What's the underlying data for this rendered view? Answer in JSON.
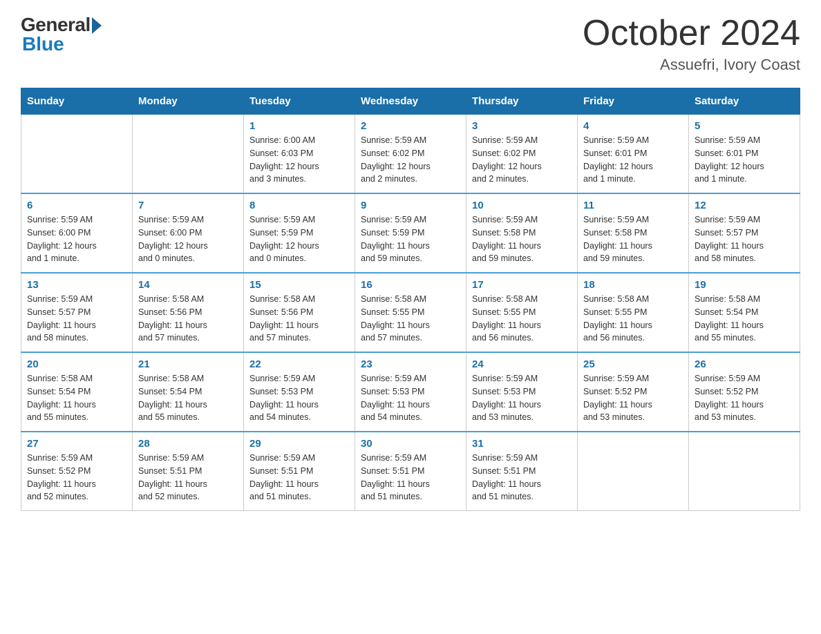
{
  "logo": {
    "general": "General",
    "blue": "Blue"
  },
  "title": "October 2024",
  "subtitle": "Assuefri, Ivory Coast",
  "weekdays": [
    "Sunday",
    "Monday",
    "Tuesday",
    "Wednesday",
    "Thursday",
    "Friday",
    "Saturday"
  ],
  "weeks": [
    [
      {
        "day": "",
        "info": ""
      },
      {
        "day": "",
        "info": ""
      },
      {
        "day": "1",
        "info": "Sunrise: 6:00 AM\nSunset: 6:03 PM\nDaylight: 12 hours\nand 3 minutes."
      },
      {
        "day": "2",
        "info": "Sunrise: 5:59 AM\nSunset: 6:02 PM\nDaylight: 12 hours\nand 2 minutes."
      },
      {
        "day": "3",
        "info": "Sunrise: 5:59 AM\nSunset: 6:02 PM\nDaylight: 12 hours\nand 2 minutes."
      },
      {
        "day": "4",
        "info": "Sunrise: 5:59 AM\nSunset: 6:01 PM\nDaylight: 12 hours\nand 1 minute."
      },
      {
        "day": "5",
        "info": "Sunrise: 5:59 AM\nSunset: 6:01 PM\nDaylight: 12 hours\nand 1 minute."
      }
    ],
    [
      {
        "day": "6",
        "info": "Sunrise: 5:59 AM\nSunset: 6:00 PM\nDaylight: 12 hours\nand 1 minute."
      },
      {
        "day": "7",
        "info": "Sunrise: 5:59 AM\nSunset: 6:00 PM\nDaylight: 12 hours\nand 0 minutes."
      },
      {
        "day": "8",
        "info": "Sunrise: 5:59 AM\nSunset: 5:59 PM\nDaylight: 12 hours\nand 0 minutes."
      },
      {
        "day": "9",
        "info": "Sunrise: 5:59 AM\nSunset: 5:59 PM\nDaylight: 11 hours\nand 59 minutes."
      },
      {
        "day": "10",
        "info": "Sunrise: 5:59 AM\nSunset: 5:58 PM\nDaylight: 11 hours\nand 59 minutes."
      },
      {
        "day": "11",
        "info": "Sunrise: 5:59 AM\nSunset: 5:58 PM\nDaylight: 11 hours\nand 59 minutes."
      },
      {
        "day": "12",
        "info": "Sunrise: 5:59 AM\nSunset: 5:57 PM\nDaylight: 11 hours\nand 58 minutes."
      }
    ],
    [
      {
        "day": "13",
        "info": "Sunrise: 5:59 AM\nSunset: 5:57 PM\nDaylight: 11 hours\nand 58 minutes."
      },
      {
        "day": "14",
        "info": "Sunrise: 5:58 AM\nSunset: 5:56 PM\nDaylight: 11 hours\nand 57 minutes."
      },
      {
        "day": "15",
        "info": "Sunrise: 5:58 AM\nSunset: 5:56 PM\nDaylight: 11 hours\nand 57 minutes."
      },
      {
        "day": "16",
        "info": "Sunrise: 5:58 AM\nSunset: 5:55 PM\nDaylight: 11 hours\nand 57 minutes."
      },
      {
        "day": "17",
        "info": "Sunrise: 5:58 AM\nSunset: 5:55 PM\nDaylight: 11 hours\nand 56 minutes."
      },
      {
        "day": "18",
        "info": "Sunrise: 5:58 AM\nSunset: 5:55 PM\nDaylight: 11 hours\nand 56 minutes."
      },
      {
        "day": "19",
        "info": "Sunrise: 5:58 AM\nSunset: 5:54 PM\nDaylight: 11 hours\nand 55 minutes."
      }
    ],
    [
      {
        "day": "20",
        "info": "Sunrise: 5:58 AM\nSunset: 5:54 PM\nDaylight: 11 hours\nand 55 minutes."
      },
      {
        "day": "21",
        "info": "Sunrise: 5:58 AM\nSunset: 5:54 PM\nDaylight: 11 hours\nand 55 minutes."
      },
      {
        "day": "22",
        "info": "Sunrise: 5:59 AM\nSunset: 5:53 PM\nDaylight: 11 hours\nand 54 minutes."
      },
      {
        "day": "23",
        "info": "Sunrise: 5:59 AM\nSunset: 5:53 PM\nDaylight: 11 hours\nand 54 minutes."
      },
      {
        "day": "24",
        "info": "Sunrise: 5:59 AM\nSunset: 5:53 PM\nDaylight: 11 hours\nand 53 minutes."
      },
      {
        "day": "25",
        "info": "Sunrise: 5:59 AM\nSunset: 5:52 PM\nDaylight: 11 hours\nand 53 minutes."
      },
      {
        "day": "26",
        "info": "Sunrise: 5:59 AM\nSunset: 5:52 PM\nDaylight: 11 hours\nand 53 minutes."
      }
    ],
    [
      {
        "day": "27",
        "info": "Sunrise: 5:59 AM\nSunset: 5:52 PM\nDaylight: 11 hours\nand 52 minutes."
      },
      {
        "day": "28",
        "info": "Sunrise: 5:59 AM\nSunset: 5:51 PM\nDaylight: 11 hours\nand 52 minutes."
      },
      {
        "day": "29",
        "info": "Sunrise: 5:59 AM\nSunset: 5:51 PM\nDaylight: 11 hours\nand 51 minutes."
      },
      {
        "day": "30",
        "info": "Sunrise: 5:59 AM\nSunset: 5:51 PM\nDaylight: 11 hours\nand 51 minutes."
      },
      {
        "day": "31",
        "info": "Sunrise: 5:59 AM\nSunset: 5:51 PM\nDaylight: 11 hours\nand 51 minutes."
      },
      {
        "day": "",
        "info": ""
      },
      {
        "day": "",
        "info": ""
      }
    ]
  ]
}
